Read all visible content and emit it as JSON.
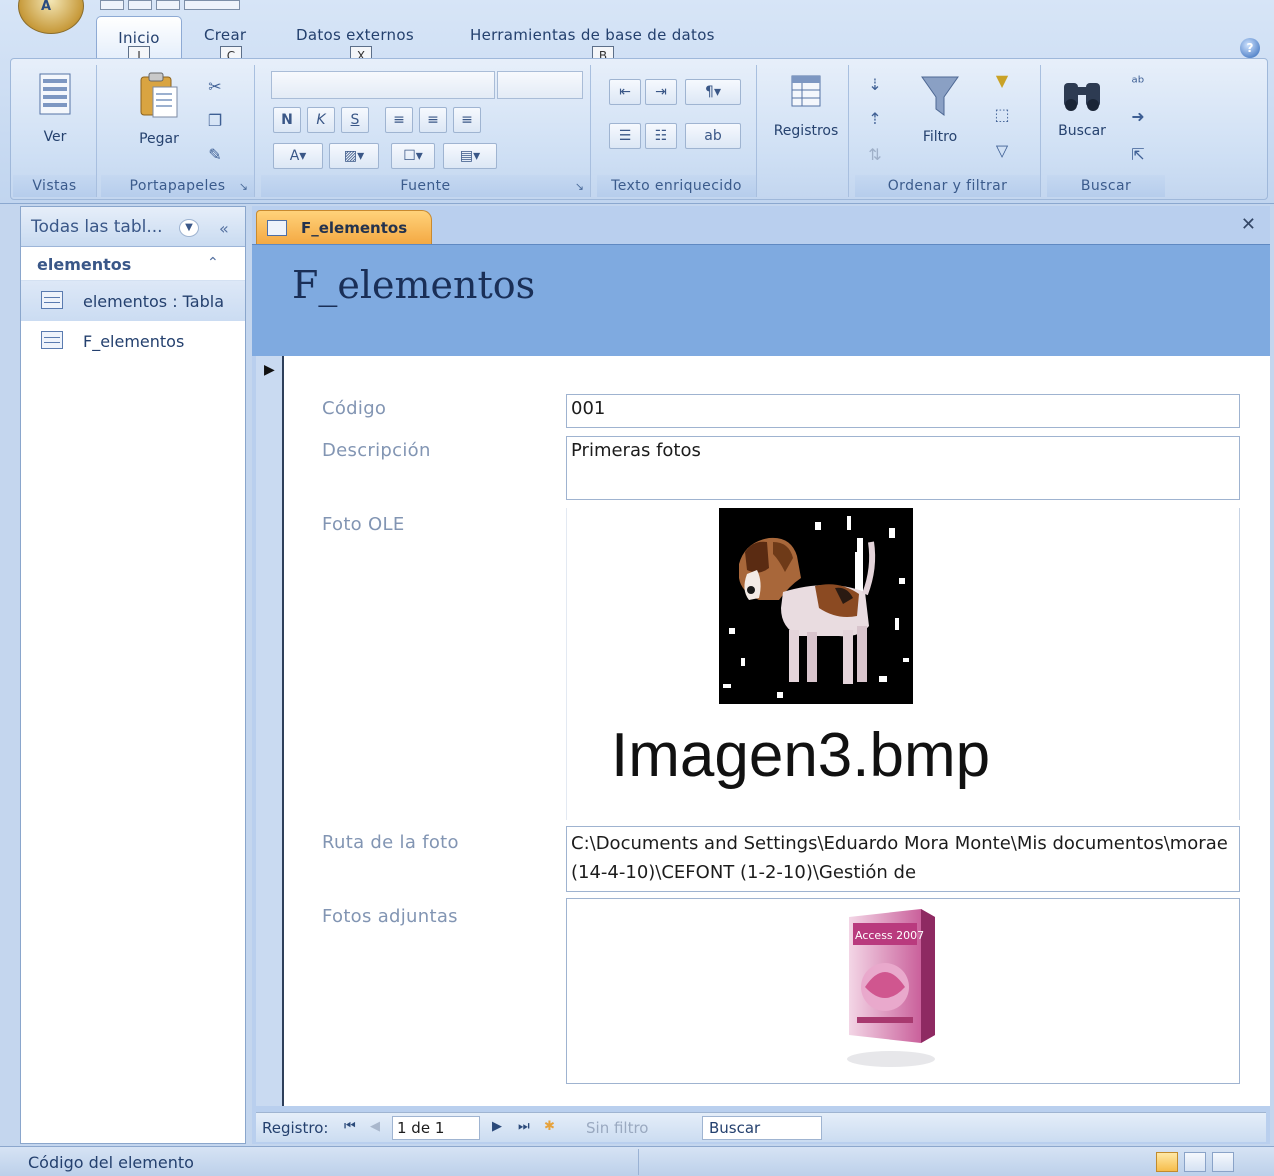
{
  "ribbon": {
    "tabs": [
      {
        "label": "Inicio",
        "keytip": "I"
      },
      {
        "label": "Crear",
        "keytip": "C"
      },
      {
        "label": "Datos externos",
        "keytip": "X"
      },
      {
        "label": "Herramientas de base de datos",
        "keytip": "B"
      }
    ],
    "groups": {
      "vistas": {
        "label": "Vistas",
        "ver": "Ver"
      },
      "portapapeles": {
        "label": "Portapapeles",
        "pegar": "Pegar"
      },
      "fuente": {
        "label": "Fuente",
        "bold": "N",
        "italic": "K",
        "underline": "S"
      },
      "texto": {
        "label": "Texto enriquecido"
      },
      "registros": {
        "label": "Registros"
      },
      "ordenar": {
        "label": "Ordenar y filtrar",
        "filtro": "Filtro"
      },
      "buscar": {
        "label": "Buscar",
        "buscar": "Buscar"
      }
    }
  },
  "nav": {
    "title": "Todas las tabl...",
    "group": "elementos",
    "items": [
      {
        "label": "elementos : Tabla",
        "icon": "table-icon"
      },
      {
        "label": "F_elementos",
        "icon": "form-icon"
      }
    ]
  },
  "document": {
    "tab_label": "F_elementos",
    "form_title": "F_elementos",
    "fields": {
      "codigo": {
        "label": "Código",
        "value": "001"
      },
      "descripcion": {
        "label": "Descripción",
        "value": "Primeras fotos"
      },
      "foto_ole": {
        "label": "Foto OLE",
        "caption": "Imagen3.bmp"
      },
      "ruta": {
        "label": "Ruta de la foto",
        "value": "C:\\Documents and Settings\\Eduardo Mora Monte\\Mis documentos\\morae (14-4-10)\\CEFONT (1-2-10)\\Gestión de"
      },
      "adjuntas": {
        "label": "Fotos adjuntas",
        "box_text": "Access 2007"
      }
    },
    "record_bar": {
      "label": "Registro:",
      "current": "1 de 1",
      "filter": "Sin filtro",
      "search": "Buscar"
    }
  },
  "status": {
    "text": "Código del elemento"
  },
  "colors": {
    "accent_tab": "#f4a943",
    "form_header": "#7faae0",
    "ribbon": "#cedff4"
  }
}
